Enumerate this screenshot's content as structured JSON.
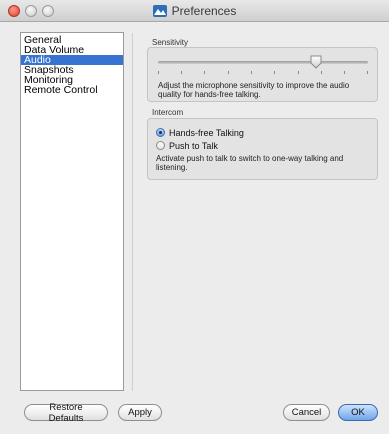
{
  "window": {
    "title": "Preferences"
  },
  "sidebar": {
    "items": [
      {
        "label": "General"
      },
      {
        "label": "Data Volume"
      },
      {
        "label": "Audio",
        "selected": true
      },
      {
        "label": "Snapshots"
      },
      {
        "label": "Monitoring"
      },
      {
        "label": "Remote Control"
      }
    ]
  },
  "sensitivity": {
    "title": "Sensitivity",
    "level": 0.75,
    "help": "Adjust the microphone sensitivity to improve the audio quality for hands-free talking."
  },
  "intercom": {
    "title": "Intercom",
    "options": [
      {
        "label": "Hands-free Talking",
        "checked": true
      },
      {
        "label": "Push to Talk",
        "checked": false
      }
    ],
    "help": "Activate push to talk to switch to one-way talking and listening."
  },
  "buttons": {
    "restore_defaults": "Restore Defaults",
    "apply": "Apply",
    "cancel": "Cancel",
    "ok": "OK"
  },
  "colors": {
    "selection": "#3774d1",
    "default_button": "#6fa6ea"
  }
}
